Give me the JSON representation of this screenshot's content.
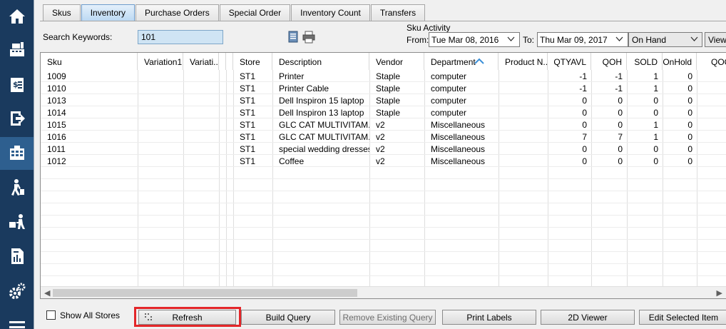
{
  "sidebar": {
    "items": [
      {
        "name": "home",
        "icon": "home-icon",
        "active": false
      },
      {
        "name": "point-of-sale",
        "icon": "cash-register-icon",
        "active": false
      },
      {
        "name": "sales",
        "icon": "dollar-document-icon",
        "active": false
      },
      {
        "name": "exit",
        "icon": "sign-out-icon",
        "active": false
      },
      {
        "name": "inventory",
        "icon": "inventory-grid-icon",
        "active": true
      },
      {
        "name": "customers",
        "icon": "person-walking-icon",
        "active": false
      },
      {
        "name": "shipping",
        "icon": "person-cart-icon",
        "active": false
      },
      {
        "name": "reports",
        "icon": "report-icon",
        "active": false
      },
      {
        "name": "settings",
        "icon": "gears-icon",
        "active": false
      },
      {
        "name": "menu",
        "icon": "hamburger-icon",
        "active": false
      }
    ],
    "colors": {
      "background": "#1a3a5e",
      "active": "#2e5f8f"
    }
  },
  "tabs": [
    {
      "label": "Skus",
      "active": false
    },
    {
      "label": "Inventory",
      "active": true
    },
    {
      "label": "Purchase Orders",
      "active": false
    },
    {
      "label": "Special Order",
      "active": false
    },
    {
      "label": "Inventory Count",
      "active": false
    },
    {
      "label": "Transfers",
      "active": false
    }
  ],
  "search": {
    "label": "Search Keywords:",
    "value": "101"
  },
  "toolbar": {
    "icons": [
      "document-icon",
      "printer-icon"
    ]
  },
  "sku_activity": {
    "title": "Sku Activity",
    "from_label": "From:",
    "from_date": "Tue  Mar 08, 2016",
    "to_label": "To:",
    "to_date": "Thu  Mar 09, 2017",
    "filter": "On Hand",
    "view_label": "View"
  },
  "grid": {
    "columns": [
      "Sku",
      "Variation1",
      "Variati...",
      "",
      "Store",
      "Description",
      "Vendor",
      "Department",
      "Product N...",
      "QTYAVL",
      "QOH",
      "SOLD",
      "OnHold",
      "QOO"
    ],
    "sort_column": "Department",
    "rows": [
      [
        "1009",
        "",
        "",
        "",
        "ST1",
        "Printer",
        "Staple",
        "computer",
        "",
        "-1",
        "-1",
        "1",
        "0"
      ],
      [
        "1010",
        "",
        "",
        "",
        "ST1",
        "Printer Cable",
        "Staple",
        "computer",
        "",
        "-1",
        "-1",
        "1",
        "0"
      ],
      [
        "1013",
        "",
        "",
        "",
        "ST1",
        "Dell Inspiron 15 laptop",
        "Staple",
        "computer",
        "",
        "0",
        "0",
        "0",
        "0"
      ],
      [
        "1014",
        "",
        "",
        "",
        "ST1",
        "Dell Inspiron 13 laptop",
        "Staple",
        "computer",
        "",
        "0",
        "0",
        "0",
        "0"
      ],
      [
        "1015",
        "",
        "",
        "",
        "ST1",
        "GLC CAT MULTIVITAM...",
        "v2",
        "Miscellaneous",
        "",
        "0",
        "0",
        "1",
        "0"
      ],
      [
        "1016",
        "",
        "",
        "",
        "ST1",
        "GLC CAT MULTIVITAM...",
        "v2",
        "Miscellaneous",
        "",
        "7",
        "7",
        "1",
        "0"
      ],
      [
        "1011",
        "",
        "",
        "",
        "ST1",
        "special wedding dresses",
        "v2",
        "Miscellaneous",
        "",
        "0",
        "0",
        "0",
        "0"
      ],
      [
        "1012",
        "",
        "",
        "",
        "ST1",
        "Coffee",
        "v2",
        "Miscellaneous",
        "",
        "0",
        "0",
        "0",
        "0"
      ]
    ]
  },
  "bottom": {
    "show_all_label": "Show All Stores",
    "show_all_checked": false,
    "buttons": [
      {
        "label": "Refresh",
        "enabled": true,
        "highlighted": true
      },
      {
        "label": "Build Query",
        "enabled": true
      },
      {
        "label": "Remove Existing Query",
        "enabled": false
      },
      {
        "label": "Print Labels",
        "enabled": true
      },
      {
        "label": "2D Viewer",
        "enabled": true
      },
      {
        "label": "Edit Selected Item",
        "enabled": true
      }
    ],
    "highlight_color": "#e32629"
  }
}
